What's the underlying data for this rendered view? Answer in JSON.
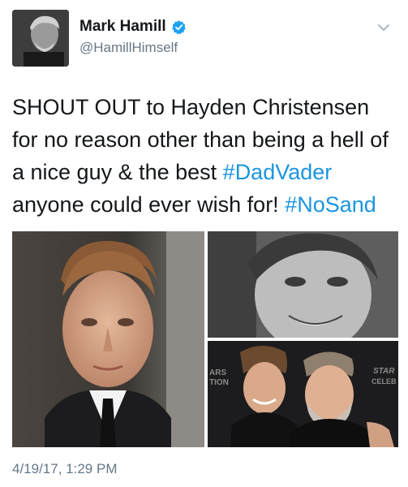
{
  "author": {
    "display_name": "Mark Hamill",
    "handle": "@HamillHimself",
    "verified": true
  },
  "tweet": {
    "text_part1": "SHOUT OUT to Hayden Christensen for no reason other than being a hell of a nice guy & the best ",
    "hashtag1": "#DadVader",
    "text_part2": " anyone could ever wish for! ",
    "hashtag2": "#NoSand",
    "timestamp": "4/19/17, 1:29 PM"
  },
  "media": {
    "bottom_right_backdrop_left": [
      "ARS",
      "TION"
    ],
    "bottom_right_backdrop_right": [
      "STAR",
      "CELEB"
    ]
  },
  "colors": {
    "link": "#1b95e0",
    "secondary_text": "#657786",
    "primary_text": "#14171a",
    "verified_badge": "#1da1f2"
  },
  "icons": {
    "verified": "verified-badge-icon",
    "menu": "chevron-down-icon"
  }
}
